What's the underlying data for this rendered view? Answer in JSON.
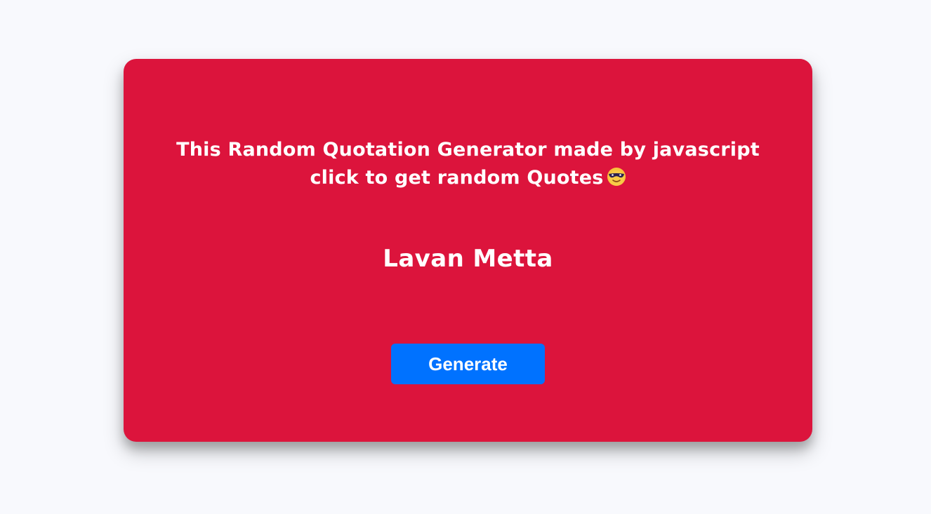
{
  "quote": {
    "line1": "This Random Quotation Generator made by javascript",
    "line2": "click to get random Quotes",
    "emoji_icon": "smiling-face-with-sunglasses-icon"
  },
  "author": "Lavan Metta",
  "generate_label": "Generate",
  "colors": {
    "background": "#f8f9fd",
    "card": "#dc143c",
    "button": "#0072ff",
    "text": "#ffffff"
  }
}
